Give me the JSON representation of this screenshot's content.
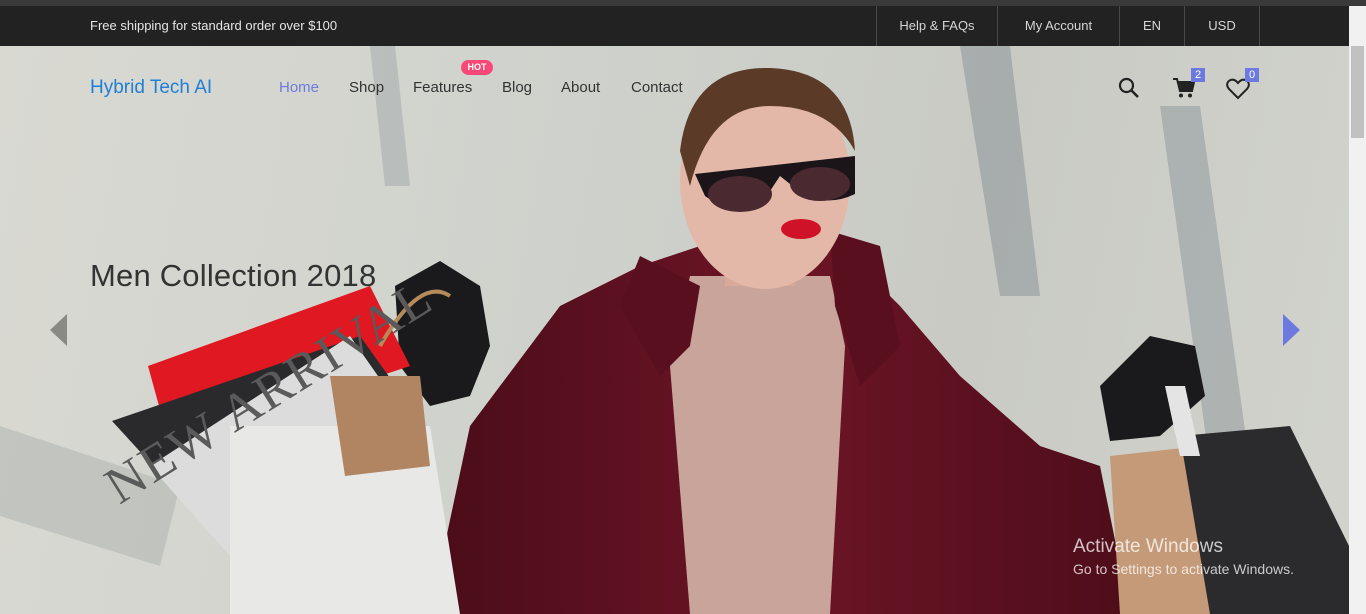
{
  "topbar": {
    "shipping_text": "Free shipping for standard order over $100",
    "links": [
      "Help & FAQs",
      "My Account",
      "EN",
      "USD"
    ]
  },
  "header": {
    "logo": "Hybrid Tech AI",
    "nav": [
      {
        "label": "Home",
        "active": true
      },
      {
        "label": "Shop",
        "active": false
      },
      {
        "label": "Features",
        "active": false
      },
      {
        "label": "Blog",
        "active": false
      },
      {
        "label": "About",
        "active": false
      },
      {
        "label": "Contact",
        "active": false
      }
    ],
    "hot_badge": "HOT",
    "icons": [
      "search-icon",
      "cart-icon",
      "heart-icon"
    ],
    "cart_count": "2",
    "wishlist_count": "0"
  },
  "hero": {
    "title": "Men Collection 2018",
    "bag_text": "NEW ARRIVAL",
    "prev_arrow": "triangle-left",
    "next_arrow": "triangle-right"
  },
  "watermark": {
    "line1": "Activate Windows",
    "line2": "Go to Settings to activate Windows."
  },
  "colors": {
    "accent": "#6c7ae0",
    "hot": "#f74877",
    "logo": "#1f7fd6",
    "topbar_bg": "#222222"
  }
}
